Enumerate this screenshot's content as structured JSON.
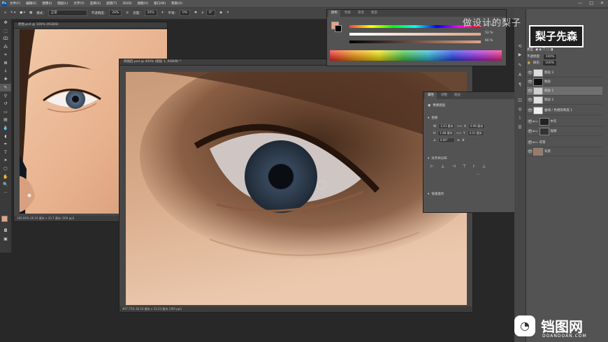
{
  "menubar": {
    "items": [
      "文件(F)",
      "编辑(E)",
      "图像(I)",
      "图层(L)",
      "文字(Y)",
      "选择(S)",
      "滤镜(T)",
      "3D(D)",
      "视图(V)",
      "窗口(W)",
      "帮助(H)"
    ],
    "window_controls": [
      "—",
      "□",
      "✕"
    ]
  },
  "options_bar": {
    "mode_label": "模式：",
    "mode_value": "正常",
    "opacity_label": "不透明度：",
    "opacity_value": "20%",
    "flow_label": "流量：",
    "flow_value": "20%",
    "smooth_label": "平滑：",
    "smooth_value": "0%",
    "angle_value": "0°"
  },
  "documents": {
    "back_title": "原图.psd @ 100% (RGB/8)",
    "back_status": "100.00%  26.16 厘米 x 33.7 厘米 (300 ppi)",
    "front_title": "修图后.psd @ 400% (图层 1, RGB/8) *",
    "front_status": "407.75%  26.16 厘米 x 33.33 厘米 (300 ppi)"
  },
  "color_panel": {
    "tabs": [
      "颜色",
      "色板",
      "渐变",
      "图案"
    ],
    "values": [
      "35",
      "52",
      "66"
    ],
    "unit": "%",
    "colors": {
      "fg": "#e0a488",
      "bg": "#000000"
    }
  },
  "properties_panel": {
    "tabs": [
      "属性",
      "调整",
      "图层"
    ],
    "heading": "像素图层",
    "transform_label": "变换",
    "w_value": "2.41 厘米",
    "h_value": "1.88 厘米",
    "x_value": "0.96 厘米",
    "y_value": "4.41 厘米",
    "angle_value": "0.00°",
    "align_label": "对齐并分布",
    "quick_label": "快速操作"
  },
  "layers_panel": {
    "kind_label": "类型",
    "opacity_label": "不透明度:",
    "opacity_value": "100%",
    "fill_label": "填充:",
    "fill_value": "100%",
    "layers": [
      {
        "name": "图层 3",
        "selected": false
      },
      {
        "name": "图层",
        "selected": false
      },
      {
        "name": "图层 1",
        "selected": true
      },
      {
        "name": "图层 2",
        "selected": false
      },
      {
        "name": "曲线 / 色相饱和度 1",
        "selected": false
      },
      {
        "name": "中灰",
        "selected": false
      },
      {
        "name": "观察",
        "selected": false
      },
      {
        "name": "背景",
        "selected": false
      }
    ]
  },
  "watermarks": {
    "top_text": "做设计的梨子 ",
    "badge_text": "梨子先森",
    "site_name": "铛图网",
    "site_url": "DOANDOAN.COM"
  }
}
